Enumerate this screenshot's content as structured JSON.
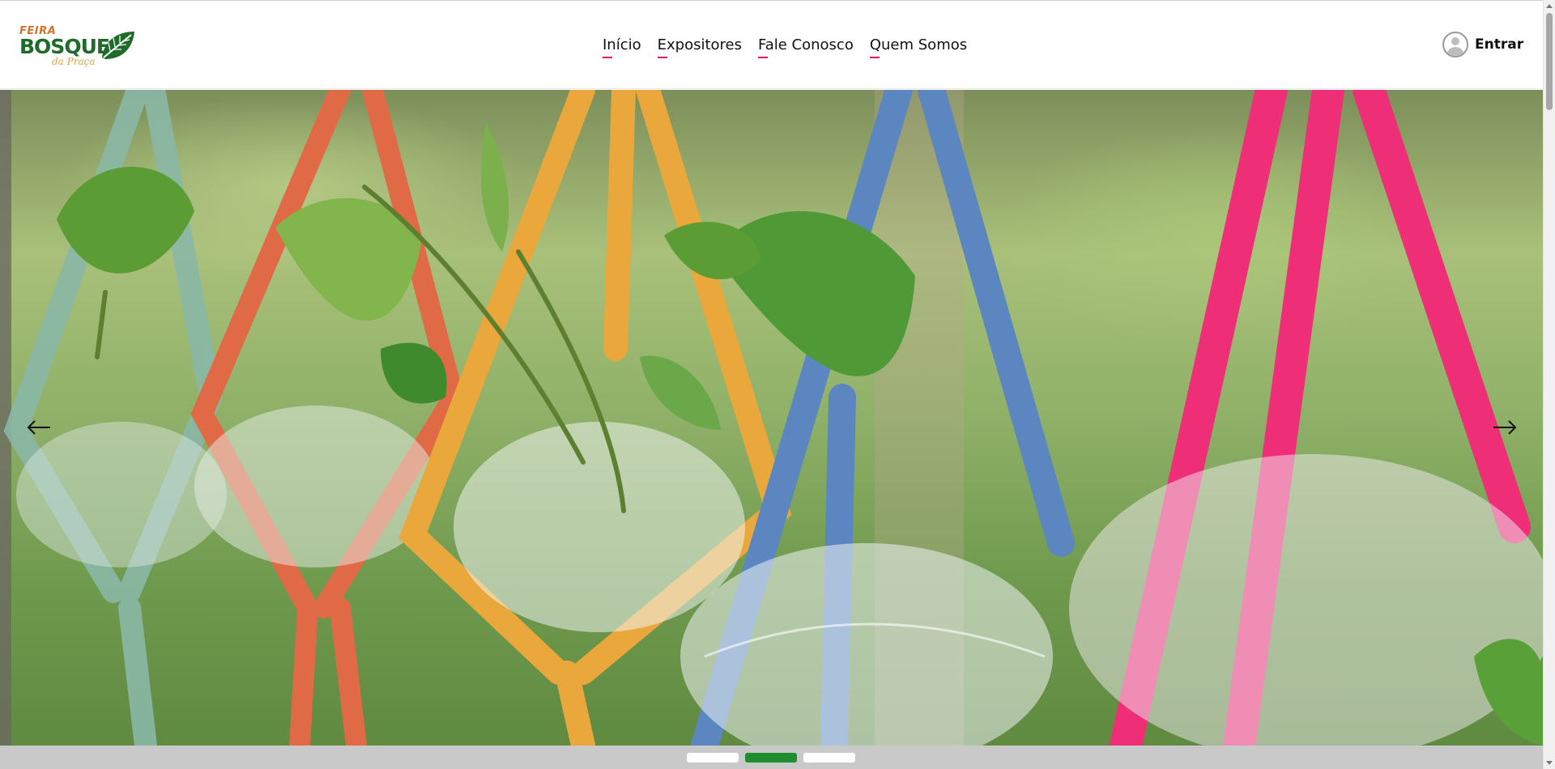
{
  "brand": {
    "line1": "FEIRA",
    "line2": "BOSQUE",
    "line3": "da Praça",
    "icon": "leaf-icon",
    "primary_color": "#1f6b2c",
    "accent_color": "#d4722a"
  },
  "nav": {
    "items": [
      {
        "label": "Início"
      },
      {
        "label": "Expositores"
      },
      {
        "label": "Fale Conosco"
      },
      {
        "label": "Quem Somos"
      }
    ],
    "underline_color": "#e4136b"
  },
  "user": {
    "login_label": "Entrar",
    "icon": "user-avatar-icon"
  },
  "hero": {
    "image": "hanging-macrame-planters-photo",
    "prev_icon": "arrow-left-icon",
    "next_icon": "arrow-right-icon"
  },
  "carousel": {
    "slides": 3,
    "active_index": 1,
    "active_color": "#1e8e2e"
  }
}
